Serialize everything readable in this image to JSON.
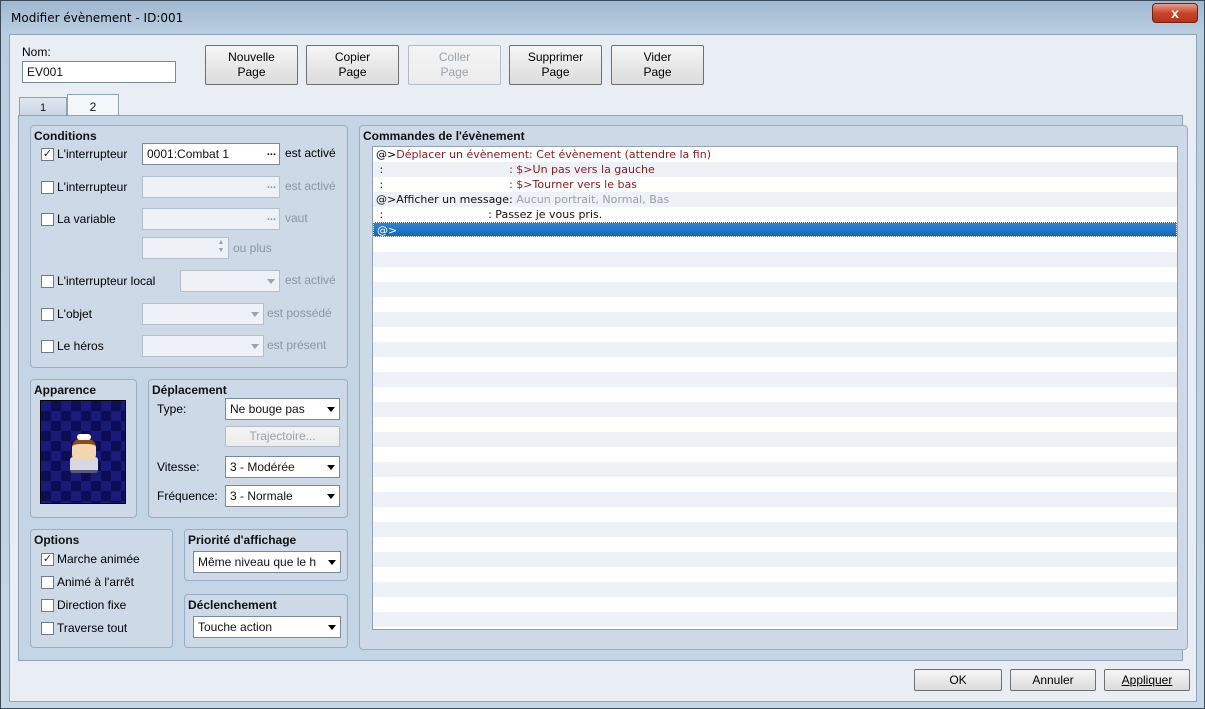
{
  "window": {
    "title": "Modifier évènement - ID:001",
    "close_label": "x"
  },
  "name": {
    "label": "Nom:",
    "value": "EV001"
  },
  "page_buttons": [
    {
      "line1": "Nouvelle",
      "line2": "Page",
      "disabled": false
    },
    {
      "line1": "Copier",
      "line2": "Page",
      "disabled": false
    },
    {
      "line1": "Coller",
      "line2": "Page",
      "disabled": true
    },
    {
      "line1": "Supprimer",
      "line2": "Page",
      "disabled": false
    },
    {
      "line1": "Vider",
      "line2": "Page",
      "disabled": false
    }
  ],
  "tabs": [
    {
      "label": "1",
      "active": false
    },
    {
      "label": "2",
      "active": true
    }
  ],
  "conditions": {
    "title": "Conditions",
    "switch1": {
      "label": "L'interrupteur",
      "checked": true,
      "value": "0001:Combat 1",
      "suffix": "est activé",
      "ellipsis": "..."
    },
    "switch2": {
      "label": "L'interrupteur",
      "checked": false,
      "value": "",
      "suffix": "est activé",
      "ellipsis": "..."
    },
    "variable": {
      "label": "La variable",
      "checked": false,
      "value": "",
      "suffix": "vaut",
      "ellipsis": "...",
      "amount_suffix": "ou plus"
    },
    "self_switch": {
      "label": "L'interrupteur local",
      "checked": false,
      "value": "",
      "suffix": "est activé"
    },
    "item": {
      "label": "L'objet",
      "checked": false,
      "value": "",
      "suffix": "est possédé"
    },
    "actor": {
      "label": "Le héros",
      "checked": false,
      "value": "",
      "suffix": "est présent"
    }
  },
  "appearance": {
    "title": "Apparence"
  },
  "movement": {
    "title": "Déplacement",
    "type_label": "Type:",
    "type_value": "Ne bouge pas",
    "route_button": "Trajectoire...",
    "speed_label": "Vitesse:",
    "speed_value": "3 - Modérée",
    "freq_label": "Fréquence:",
    "freq_value": "3 - Normale"
  },
  "options": {
    "title": "Options",
    "items": [
      {
        "label": "Marche animée",
        "checked": true
      },
      {
        "label": "Animé à l'arrêt",
        "checked": false
      },
      {
        "label": "Direction fixe",
        "checked": false
      },
      {
        "label": "Traverse tout",
        "checked": false
      }
    ]
  },
  "priority": {
    "title": "Priorité d'affichage",
    "value": "Même niveau que le h"
  },
  "trigger": {
    "title": "Déclenchement",
    "value": "Touche action"
  },
  "commands": {
    "title": "Commandes de l'évènement",
    "rows": [
      {
        "a": "@>Déplacer un évènement: ",
        "b": "Cet évènement (attendre la fin)",
        "style": "red"
      },
      {
        "a": " :                                    ",
        "b": ": $>Un pas vers la gauche",
        "style": "red"
      },
      {
        "a": " :                                    ",
        "b": ": $>Tourner vers le bas",
        "style": "red"
      },
      {
        "a": "@>Afficher un message: ",
        "b": "Aucun portrait, Normal, Bas",
        "style": "gray"
      },
      {
        "a": " :                              ",
        "b": ": Passez je vous pris.",
        "style": "plain"
      },
      {
        "a": "@>",
        "b": "",
        "style": "sel"
      }
    ]
  },
  "footer": {
    "ok": "OK",
    "cancel": "Annuler",
    "apply": "Appliquer"
  }
}
